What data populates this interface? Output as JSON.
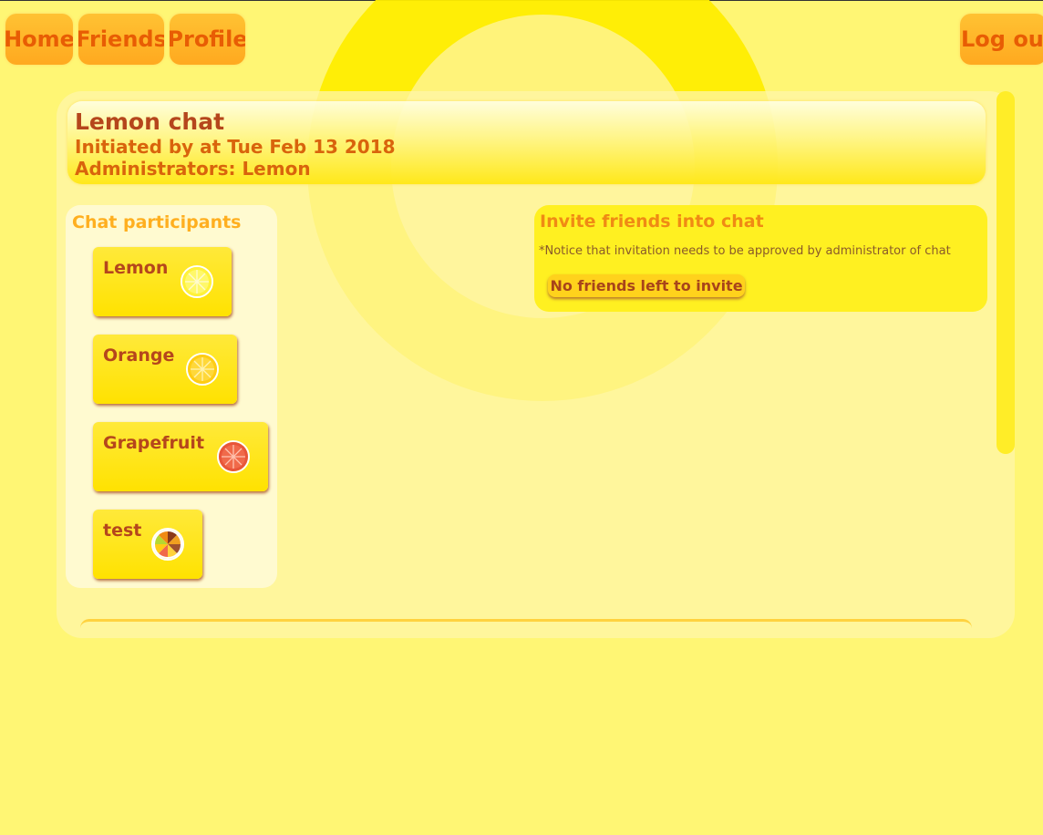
{
  "nav": {
    "home": "Home",
    "friends": "Friends",
    "profile": "Profile",
    "logout": "Log out"
  },
  "chat": {
    "title": "Lemon chat",
    "initiated": "Initiated by at Tue Feb 13 2018",
    "administrators": "Administrators: Lemon"
  },
  "participants": {
    "title": "Chat participants",
    "items": [
      {
        "name": "Lemon",
        "icon": "lemon-icon"
      },
      {
        "name": "Orange",
        "icon": "orange-icon"
      },
      {
        "name": "Grapefruit",
        "icon": "grapefruit-icon"
      },
      {
        "name": "test",
        "icon": "mixed-fruit-icon"
      }
    ]
  },
  "invite": {
    "title": "Invite friends into chat",
    "notice": "*Notice that invitation needs to be approved by administrator of chat",
    "button": "No friends left to invite"
  },
  "colors": {
    "background": "#fff674",
    "nav_button": "#ffb12a",
    "nav_text": "#e85d04",
    "title_text": "#b5461c",
    "accent_orange": "#f08a14"
  }
}
